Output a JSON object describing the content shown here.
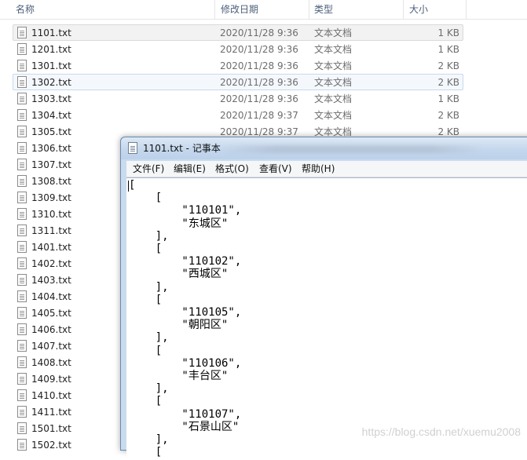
{
  "explorer": {
    "columns": {
      "name": "名称",
      "modified": "修改日期",
      "type": "类型",
      "size": "大小"
    },
    "files": [
      {
        "name": "1101.txt",
        "date": "2020/11/28 9:36",
        "type": "文本文档",
        "size": "1 KB"
      },
      {
        "name": "1201.txt",
        "date": "2020/11/28 9:36",
        "type": "文本文档",
        "size": "1 KB"
      },
      {
        "name": "1301.txt",
        "date": "2020/11/28 9:36",
        "type": "文本文档",
        "size": "2 KB"
      },
      {
        "name": "1302.txt",
        "date": "2020/11/28 9:36",
        "type": "文本文档",
        "size": "2 KB"
      },
      {
        "name": "1303.txt",
        "date": "2020/11/28 9:36",
        "type": "文本文档",
        "size": "1 KB"
      },
      {
        "name": "1304.txt",
        "date": "2020/11/28 9:37",
        "type": "文本文档",
        "size": "2 KB"
      },
      {
        "name": "1305.txt",
        "date": "2020/11/28 9:37",
        "type": "文本文档",
        "size": "2 KB"
      },
      {
        "name": "1306.txt",
        "date": "",
        "type": "",
        "size": ""
      },
      {
        "name": "1307.txt",
        "date": "",
        "type": "",
        "size": ""
      },
      {
        "name": "1308.txt",
        "date": "",
        "type": "",
        "size": ""
      },
      {
        "name": "1309.txt",
        "date": "",
        "type": "",
        "size": ""
      },
      {
        "name": "1310.txt",
        "date": "",
        "type": "",
        "size": ""
      },
      {
        "name": "1311.txt",
        "date": "",
        "type": "",
        "size": ""
      },
      {
        "name": "1401.txt",
        "date": "",
        "type": "",
        "size": ""
      },
      {
        "name": "1402.txt",
        "date": "",
        "type": "",
        "size": ""
      },
      {
        "name": "1403.txt",
        "date": "",
        "type": "",
        "size": ""
      },
      {
        "name": "1404.txt",
        "date": "",
        "type": "",
        "size": ""
      },
      {
        "name": "1405.txt",
        "date": "",
        "type": "",
        "size": ""
      },
      {
        "name": "1406.txt",
        "date": "",
        "type": "",
        "size": ""
      },
      {
        "name": "1407.txt",
        "date": "",
        "type": "",
        "size": ""
      },
      {
        "name": "1408.txt",
        "date": "",
        "type": "",
        "size": ""
      },
      {
        "name": "1409.txt",
        "date": "",
        "type": "",
        "size": ""
      },
      {
        "name": "1410.txt",
        "date": "",
        "type": "",
        "size": ""
      },
      {
        "name": "1411.txt",
        "date": "",
        "type": "",
        "size": ""
      },
      {
        "name": "1501.txt",
        "date": "",
        "type": "",
        "size": ""
      },
      {
        "name": "1502.txt",
        "date": "",
        "type": "",
        "size": ""
      }
    ],
    "hover_index": 0,
    "selected_index": 3,
    "file_icon": "text-file-icon"
  },
  "notepad": {
    "title": "1101.txt - 记事本",
    "icon": "notepad-icon",
    "menu": [
      "文件(F)",
      "编辑(E)",
      "格式(O)",
      "查看(V)",
      "帮助(H)"
    ],
    "content": "[\n    [\n        \"110101\",\n        \"东城区\"\n    ],\n    [\n        \"110102\",\n        \"西城区\"\n    ],\n    [\n        \"110105\",\n        \"朝阳区\"\n    ],\n    [\n        \"110106\",\n        \"丰台区\"\n    ],\n    [\n        \"110107\",\n        \"石景山区\"\n    ],\n    ["
  },
  "watermark": "https://blog.csdn.net/xuemu2008",
  "colors": {
    "header_text": "#4c607a",
    "meta_text": "#6d6d6d",
    "selection_bg": "#f4f8fd",
    "selection_border": "#c8d9ee",
    "window_frame": "#c8dbef"
  }
}
